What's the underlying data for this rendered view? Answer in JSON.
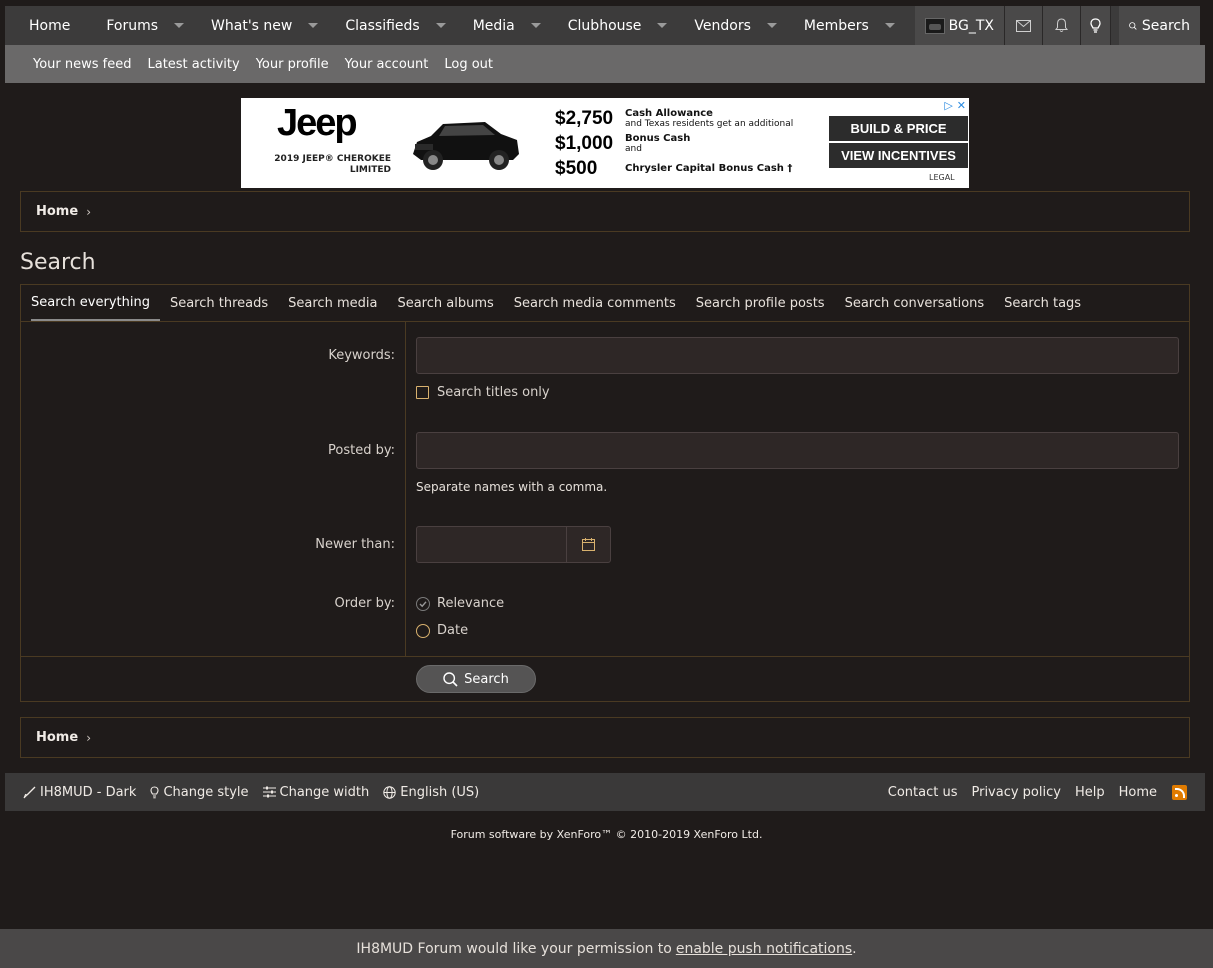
{
  "nav": {
    "items": [
      "Home",
      "Forums",
      "What's new",
      "Classifieds",
      "Media",
      "Clubhouse",
      "Vendors",
      "Members"
    ],
    "username": "BG_TX",
    "search_label": "Search"
  },
  "subnav": [
    "Your news feed",
    "Latest activity",
    "Your profile",
    "Your account",
    "Log out"
  ],
  "ad": {
    "logo": "Jeep",
    "model_line1": "2019 JEEP® CHEROKEE",
    "model_line2": "LIMITED",
    "offers": [
      {
        "amount": "$2,750",
        "text": "Cash Allowance",
        "sub": "and Texas residents get an additional"
      },
      {
        "amount": "$1,000",
        "text": "Bonus Cash",
        "sub": "and"
      },
      {
        "amount": "$500",
        "text": "Chrysler Capital Bonus Cash †",
        "sub": ""
      }
    ],
    "btn_build": "BUILD & PRICE",
    "btn_incentives": "VIEW INCENTIVES",
    "legal": "LEGAL"
  },
  "breadcrumb": {
    "home": "Home"
  },
  "page_title": "Search",
  "tabs": [
    "Search everything",
    "Search threads",
    "Search media",
    "Search albums",
    "Search media comments",
    "Search profile posts",
    "Search conversations",
    "Search tags"
  ],
  "form": {
    "keywords_label": "Keywords:",
    "titles_only_label": "Search titles only",
    "posted_by_label": "Posted by:",
    "posted_by_hint": "Separate names with a comma.",
    "newer_than_label": "Newer than:",
    "order_by_label": "Order by:",
    "order_relevance": "Relevance",
    "order_date": "Date",
    "submit_label": "Search"
  },
  "footer": {
    "style": "IH8MUD - Dark",
    "change_style": "Change style",
    "change_width": "Change width",
    "language": "English (US)",
    "contact": "Contact us",
    "privacy": "Privacy policy",
    "help": "Help",
    "home": "Home"
  },
  "copyright": "Forum software by XenForo™ © 2010-2019 XenForo Ltd.",
  "push": {
    "text": "IH8MUD Forum would like your permission to",
    "link": "enable push notifications",
    "end": "."
  }
}
